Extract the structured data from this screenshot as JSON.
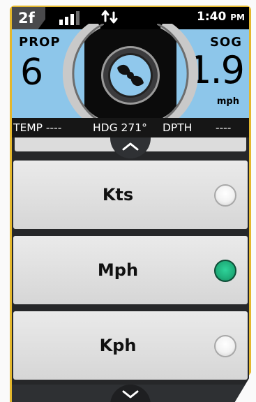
{
  "status": {
    "channel": "2f",
    "signal_bars_active": 3,
    "signal_bars_total": 4,
    "time": "1:40",
    "ampm": "PM"
  },
  "gauges": {
    "prop": {
      "label": "PROP",
      "value": "6"
    },
    "sog": {
      "label": "SOG",
      "value": "1.9",
      "unit": "mph"
    },
    "center_icon": "propeller-icon"
  },
  "info": {
    "temp_label": "TEMP",
    "temp_value": "----",
    "hdg_label": "HDG",
    "hdg_value": "271°",
    "dpth_label": "DPTH",
    "dpth_value": "----"
  },
  "units": {
    "options": [
      {
        "label": "Kts",
        "selected": false
      },
      {
        "label": "Mph",
        "selected": true
      },
      {
        "label": "Kph",
        "selected": false
      }
    ]
  },
  "colors": {
    "frame": "#e3b72d",
    "gauge_blue": "#8dc6ea",
    "selected_green": "#1fae7a"
  }
}
